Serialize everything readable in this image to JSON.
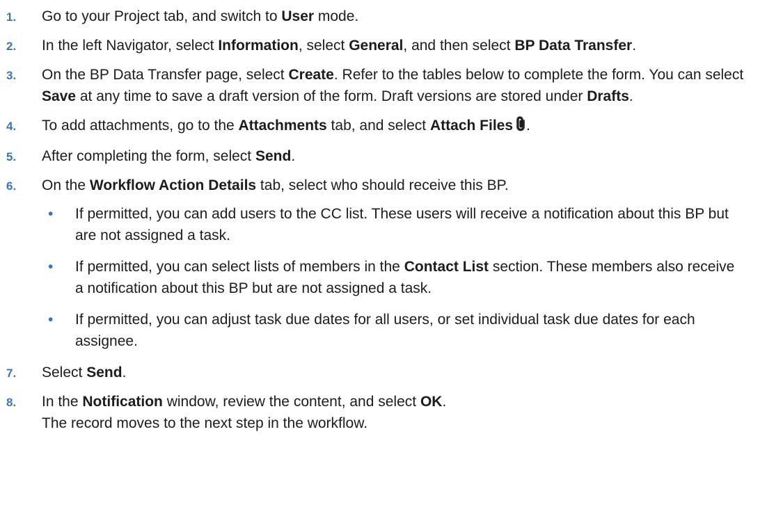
{
  "steps": [
    {
      "num": "1.",
      "parts": [
        {
          "t": "Go to your Project tab, and switch to "
        },
        {
          "b": "User"
        },
        {
          "t": " mode."
        }
      ]
    },
    {
      "num": "2.",
      "parts": [
        {
          "t": "In the left Navigator, select "
        },
        {
          "b": "Information"
        },
        {
          "t": ", select "
        },
        {
          "b": "General"
        },
        {
          "t": ", and then select "
        },
        {
          "b": "BP Data Transfer"
        },
        {
          "t": "."
        }
      ]
    },
    {
      "num": "3.",
      "parts": [
        {
          "t": "On the BP Data Transfer page, select "
        },
        {
          "b": "Create"
        },
        {
          "t": ". Refer to the tables below to complete the form. You can select "
        },
        {
          "b": "Save"
        },
        {
          "t": " at any time to save a draft version of the form. Draft versions are stored under "
        },
        {
          "b": "Drafts"
        },
        {
          "t": "."
        }
      ]
    },
    {
      "num": "4.",
      "parts": [
        {
          "t": "To add attachments, go to the "
        },
        {
          "b": "Attachments"
        },
        {
          "t": " tab, and select "
        },
        {
          "b": "Attach Files"
        },
        {
          "icon": "paperclip-icon"
        },
        {
          "t": "."
        }
      ]
    },
    {
      "num": "5.",
      "parts": [
        {
          "t": "After completing the form, select "
        },
        {
          "b": "Send"
        },
        {
          "t": "."
        }
      ]
    },
    {
      "num": "6.",
      "parts": [
        {
          "t": "On the "
        },
        {
          "b": "Workflow Action Details"
        },
        {
          "t": " tab, select who should receive this BP."
        }
      ],
      "bullets": [
        [
          {
            "t": "If permitted, you can add users to the CC list. These users will receive a notification about this BP but are not assigned a task."
          }
        ],
        [
          {
            "t": "If permitted, you can select lists of members in the "
          },
          {
            "b": "Contact List"
          },
          {
            "t": " section. These members also receive a notification about this BP but are not assigned a task."
          }
        ],
        [
          {
            "t": "If permitted, you can adjust task due dates for all users, or set individual task due dates for each assignee."
          }
        ]
      ]
    },
    {
      "num": "7.",
      "parts": [
        {
          "t": "Select "
        },
        {
          "b": "Send"
        },
        {
          "t": "."
        }
      ]
    },
    {
      "num": "8.",
      "parts": [
        {
          "t": "In the "
        },
        {
          "b": "Notification"
        },
        {
          "t": " window, review the content, and select "
        },
        {
          "b": "OK"
        },
        {
          "t": "."
        },
        {
          "br": true
        },
        {
          "t": "The record moves to the next step in the workflow."
        }
      ]
    }
  ],
  "bullet_glyph": "•",
  "colors": {
    "number": "#3a74b9",
    "text": "#1c1c1c"
  }
}
